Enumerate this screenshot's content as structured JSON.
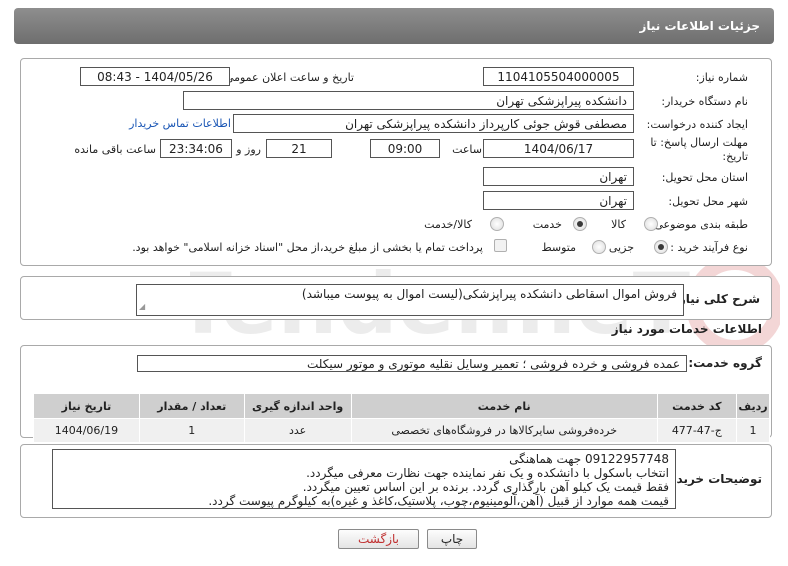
{
  "header": {
    "title": "جزئیات اطلاعات نیاز"
  },
  "form": {
    "need_number_label": "شماره نیاز:",
    "need_number": "1104105504000005",
    "announce_label": "تاریخ و ساعت اعلان عمومی:",
    "announce_value": "1404/05/26 - 08:43",
    "buyer_label": "نام دستگاه خریدار:",
    "buyer_value": "دانشکده پیراپزشکی تهران",
    "creator_label": "ایجاد کننده درخواست:",
    "creator_value": "مصطفی قوش جوئی کارپرداز دانشکده پیراپزشکی تهران",
    "contact_link": "اطلاعات تماس خریدار",
    "deadline_label_1": "مهلت ارسال پاسخ: تا",
    "deadline_label_2": "تاریخ:",
    "deadline_date": "1404/06/17",
    "time_label": "ساعت",
    "deadline_time": "09:00",
    "days_value": "21",
    "days_label": "روز و",
    "remaining_time": "23:34:06",
    "remaining_label": "ساعت باقی مانده",
    "province_label": "استان محل تحویل:",
    "province_value": "تهران",
    "city_label": "شهر محل تحویل:",
    "city_value": "تهران",
    "category_label": "طبقه بندی موضوعی:",
    "category_options": [
      "کالا",
      "خدمت",
      "کالا/خدمت"
    ],
    "category_selected": "خدمت",
    "process_label": "نوع فرآیند خرید :",
    "process_options": [
      "جزیی",
      "متوسط"
    ],
    "process_selected": "جزیی",
    "payment_note": "پرداخت تمام یا بخشی از مبلغ خرید،از محل \"اسناد خزانه اسلامی\" خواهد بود."
  },
  "summary": {
    "label": "شرح کلی نیاز:",
    "value": "فروش اموال اسقاطی دانشکده پیراپزشکی(لیست اموال به پیوست میباشد)"
  },
  "services": {
    "section_title": "اطلاعات خدمات مورد نیاز",
    "group_label": "گروه خدمت:",
    "group_value": "عمده فروشی و خرده فروشی ؛ تعمیر وسایل نقلیه موتوری و موتور سیکلت",
    "columns": [
      "ردیف",
      "کد خدمت",
      "نام خدمت",
      "واحد اندازه گیری",
      "تعداد / مقدار",
      "تاریخ نیاز"
    ],
    "rows": [
      [
        "1",
        "ج-47-477",
        "خرده‌فروشی سایرکالاها در فروشگاه‌های تخصصی",
        "عدد",
        "1",
        "1404/06/19"
      ]
    ]
  },
  "buyer_notes": {
    "label": "توضیحات خریدار:",
    "lines": [
      "09122957748 جهت هماهنگی",
      "انتخاب باسکول با دانشکده و یک نفر نماینده جهت نظارت معرفی میگردد.",
      "فقط قیمت یک کیلو آهن بارگذاری گردد. برنده بر این اساس تعیین میگردد.",
      "قیمت همه موارد از قبیل (آهن،آلومینیوم،چوب، پلاستیک،کاغذ و غیره)به کیلوگرم پیوست گردد."
    ]
  },
  "buttons": {
    "print": "چاپ",
    "back": "بازگشت"
  },
  "watermark": {
    "text": "AriaTender.neT"
  }
}
